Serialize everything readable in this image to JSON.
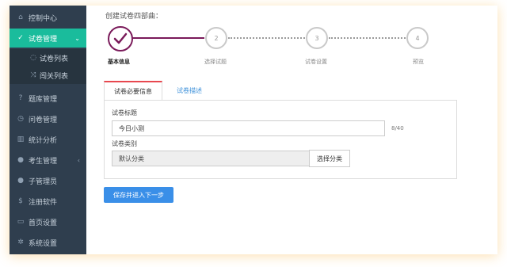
{
  "sidebar": {
    "items": [
      {
        "label": "控制中心",
        "icon": "home-icon",
        "glyph": "⌂"
      },
      {
        "label": "试卷管理",
        "icon": "check-circle-icon",
        "glyph": "✓",
        "active": true,
        "arrow": "⌄"
      },
      {
        "label": "试卷列表",
        "icon": "check-circle-icon",
        "glyph": "◌"
      },
      {
        "label": "闯关列表",
        "icon": "shuffle-icon",
        "glyph": "⤨"
      },
      {
        "label": "题库管理",
        "icon": "question-icon",
        "glyph": "?"
      },
      {
        "label": "问卷管理",
        "icon": "clock-icon",
        "glyph": "◷"
      },
      {
        "label": "统计分析",
        "icon": "bar-chart-icon",
        "glyph": "▥"
      },
      {
        "label": "考生管理",
        "icon": "user-icon",
        "glyph": "●",
        "arrow": "‹"
      },
      {
        "label": "子管理员",
        "icon": "user-admin-icon",
        "glyph": "●"
      },
      {
        "label": "注册软件",
        "icon": "dollar-icon",
        "glyph": "$"
      },
      {
        "label": "首页设置",
        "icon": "monitor-icon",
        "glyph": "▭"
      },
      {
        "label": "系统设置",
        "icon": "gear-icon",
        "glyph": "✲"
      }
    ]
  },
  "steps": {
    "title": "创建试卷四部曲：",
    "items": [
      {
        "number": "",
        "label": "基本信息",
        "done": true
      },
      {
        "number": "2",
        "label": "选择试题"
      },
      {
        "number": "3",
        "label": "试卷设置"
      },
      {
        "number": "4",
        "label": "预览"
      }
    ]
  },
  "tabs": [
    {
      "label": "试卷必要信息",
      "active": true
    },
    {
      "label": "试卷描述"
    }
  ],
  "form": {
    "title_label": "试卷标题",
    "title_value": "今日小测",
    "title_counter": "8/40",
    "category_label": "试卷类别",
    "category_value": "默认分类",
    "choose_button": "选择分类"
  },
  "submit_button": "保存并进入下一步",
  "colors": {
    "sidebar_bg": "#2f3e4e",
    "active_item": "#1abc9c",
    "step_done": "#7a1a5a",
    "primary_button": "#3a8fe8",
    "tab_accent": "#e8484f"
  }
}
